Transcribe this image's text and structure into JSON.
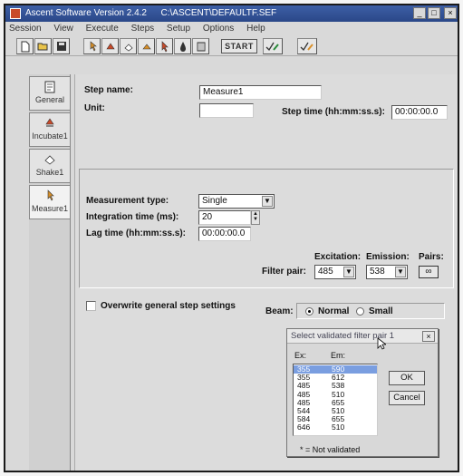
{
  "window": {
    "title": "Ascent Software Version 2.4.2",
    "file_path": "C:\\ASCENT\\DEFAULTF.SEF",
    "controls": [
      "_",
      "□",
      "×"
    ]
  },
  "menu": [
    "Session",
    "View",
    "Execute",
    "Steps",
    "Setup",
    "Options",
    "Help"
  ],
  "toolbar": {
    "start_label": "START"
  },
  "sidebar": {
    "items": [
      {
        "label": "General",
        "icon": "document-icon"
      },
      {
        "label": "Incubate1",
        "icon": "incubate-icon"
      },
      {
        "label": "Shake1",
        "icon": "shake-icon"
      },
      {
        "label": "Measure1",
        "icon": "measure-icon"
      }
    ]
  },
  "step": {
    "name_label": "Step name:",
    "name_value": "Measure1",
    "unit_label": "Unit:",
    "unit_value": "",
    "time_label": "Step time (hh:mm:ss.s):",
    "time_value": "00:00:00.0"
  },
  "measurement": {
    "type_label": "Measurement type:",
    "type_value": "Single",
    "integration_label": "Integration time (ms):",
    "integration_value": "20",
    "lag_label": "Lag time (hh:mm:ss.s):",
    "lag_value": "00:00:00.0",
    "filter_pair_label": "Filter pair:",
    "excitation_label": "Excitation:",
    "excitation_value": "485",
    "emission_label": "Emission:",
    "emission_value": "538",
    "pairs_label": "Pairs:",
    "pairs_symbol": "∞"
  },
  "overwrite_label": "Overwrite general step settings",
  "beam": {
    "label": "Beam:",
    "normal_label": "Normal",
    "small_label": "Small",
    "selected": "Normal"
  },
  "dialog": {
    "title": "Select validated filter pair 1",
    "col_ex": "Ex:",
    "col_em": "Em:",
    "rows": [
      {
        "ex": "355",
        "em": "590"
      },
      {
        "ex": "355",
        "em": "612"
      },
      {
        "ex": "485",
        "em": "538"
      },
      {
        "ex": "485",
        "em": "510"
      },
      {
        "ex": "485",
        "em": "655"
      },
      {
        "ex": "544",
        "em": "510"
      },
      {
        "ex": "584",
        "em": "655"
      },
      {
        "ex": "646",
        "em": "510"
      }
    ],
    "selected_index": 0,
    "ok_label": "OK",
    "cancel_label": "Cancel",
    "note": "* = Not validated",
    "close_symbol": "×"
  }
}
